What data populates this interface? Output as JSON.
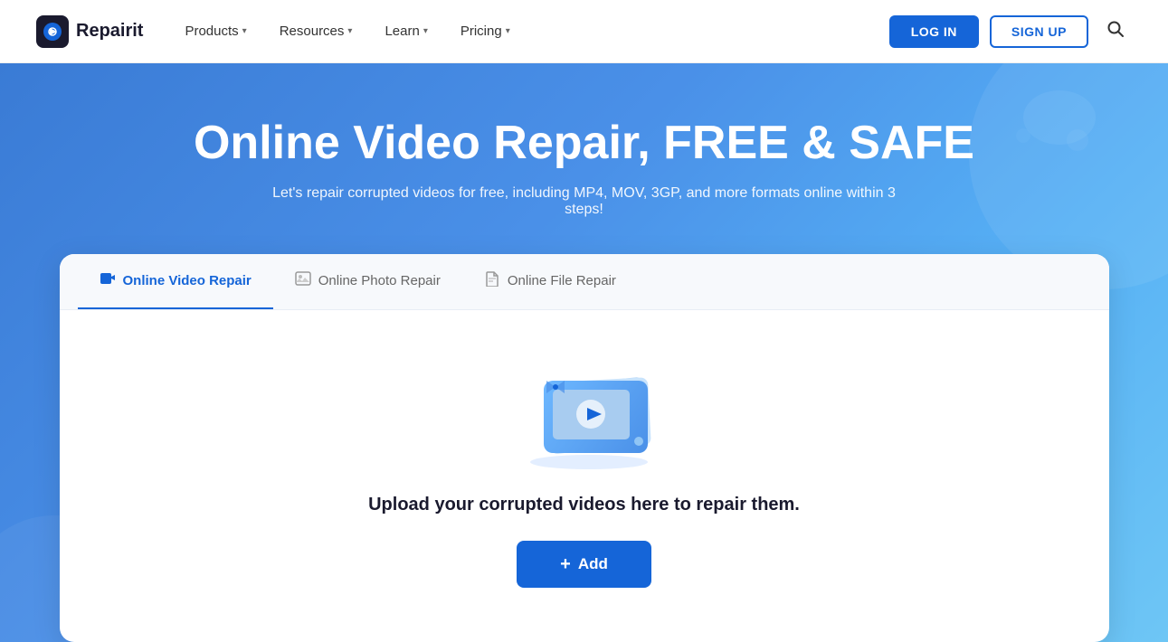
{
  "navbar": {
    "logo_text": "Repairit",
    "nav_items": [
      {
        "label": "Products",
        "has_chevron": true
      },
      {
        "label": "Resources",
        "has_chevron": true
      },
      {
        "label": "Learn",
        "has_chevron": true
      },
      {
        "label": "Pricing",
        "has_chevron": true
      }
    ],
    "btn_login": "LOG IN",
    "btn_signup": "SIGN UP"
  },
  "hero": {
    "title": "Online Video Repair, FREE & SAFE",
    "subtitle": "Let's repair corrupted videos for free, including MP4, MOV, 3GP, and more formats online within 3 steps!"
  },
  "card": {
    "tabs": [
      {
        "label": "Online Video Repair",
        "icon": "video",
        "active": true
      },
      {
        "label": "Online Photo Repair",
        "icon": "photo",
        "active": false
      },
      {
        "label": "Online File Repair",
        "icon": "file",
        "active": false
      }
    ],
    "upload_text": "Upload your corrupted videos here to repair them.",
    "add_button_label": "Add"
  }
}
